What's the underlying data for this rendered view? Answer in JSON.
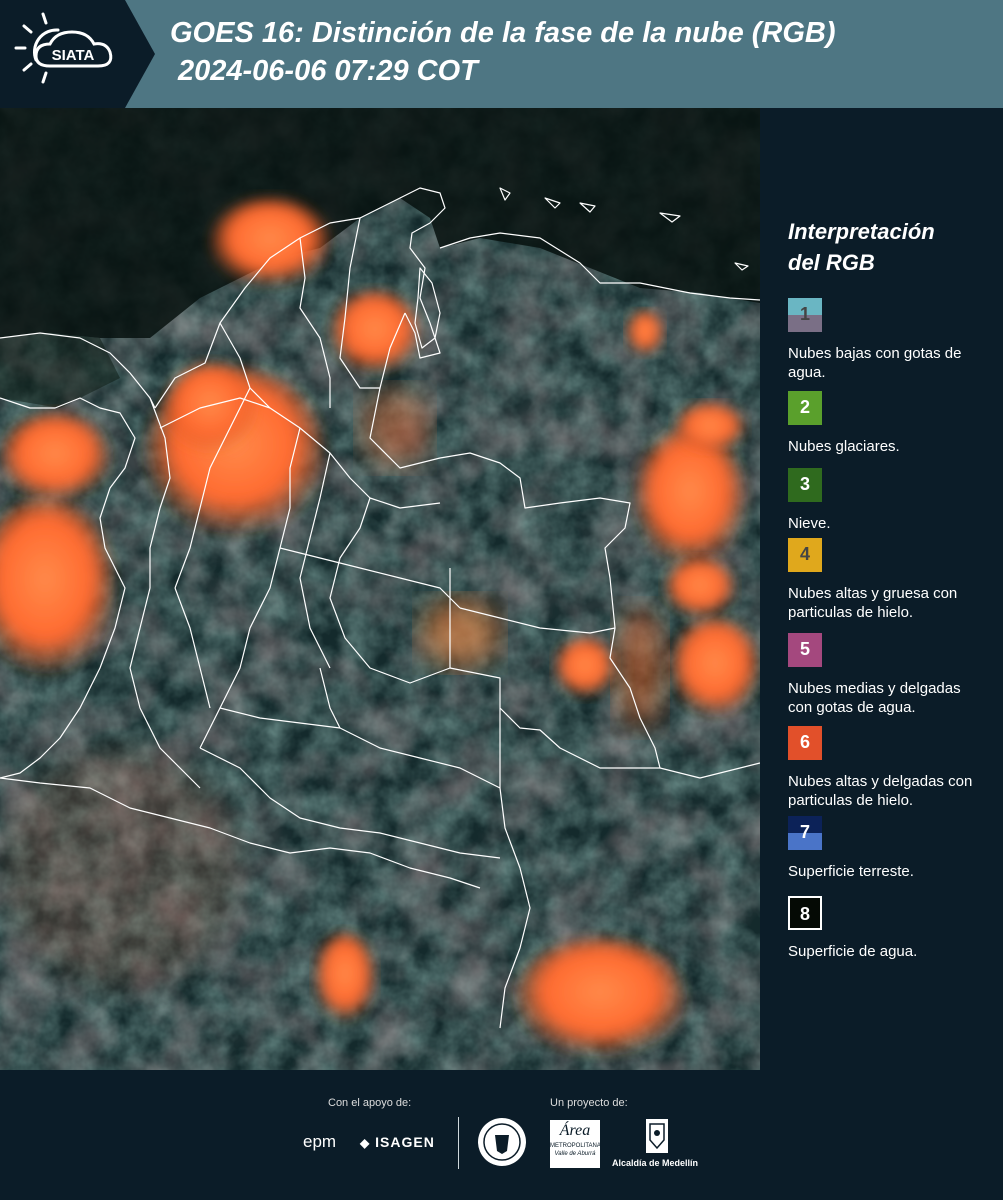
{
  "header": {
    "logo_text": "SIATA",
    "title_line1": "GOES 16: Distinción de la fase de la nube (RGB)",
    "title_line2": "2024-06-06 07:29 COT",
    "bg_color": "#4e7683"
  },
  "legend": {
    "title_line1": "Interpretación",
    "title_line2": "del RGB",
    "items": [
      {
        "num": "1",
        "label": "Nubes bajas con gotas de agua.",
        "color_top": "#6ab6c3",
        "color_bottom": "#7a6f86"
      },
      {
        "num": "2",
        "label": "Nubes glaciares.",
        "color_top": "#5aa02c",
        "color_bottom": "#5aa02c"
      },
      {
        "num": "3",
        "label": "Nieve.",
        "color_top": "#2f6a1e",
        "color_bottom": "#2f6a1e"
      },
      {
        "num": "4",
        "label": "Nubes altas y gruesa con particulas de hielo.",
        "color_top": "#e0a81c",
        "color_bottom": "#e0a81c"
      },
      {
        "num": "5",
        "label": "Nubes medias y delgadas con gotas de agua.",
        "color_top": "#a4487e",
        "color_bottom": "#a4487e"
      },
      {
        "num": "6",
        "label": "Nubes altas y delgadas con particulas de hielo.",
        "color_top": "#e2502a",
        "color_bottom": "#e2502a"
      },
      {
        "num": "7",
        "label": "Superficie terreste.",
        "color_top": "#0c2258",
        "color_bottom": "#4a74c8"
      },
      {
        "num": "8",
        "label": "Superficie de agua.",
        "color_top": "#050a05",
        "color_bottom": "#050a05"
      }
    ]
  },
  "footer": {
    "support_label": "Con el apoyo de:",
    "project_label": "Un proyecto de:",
    "epm": "epm",
    "isagen": "ISAGEN",
    "area_metro": "Área",
    "area_metro_sub": "METROPOLITANA",
    "area_metro_sub2": "Valle de Aburrá",
    "alcaldia": "Alcaldía de Medellín"
  },
  "map": {
    "type": "satellite RGB cloud phase composite",
    "cloud_color": "#ff6a30",
    "boundary_color": "#ffffff"
  }
}
